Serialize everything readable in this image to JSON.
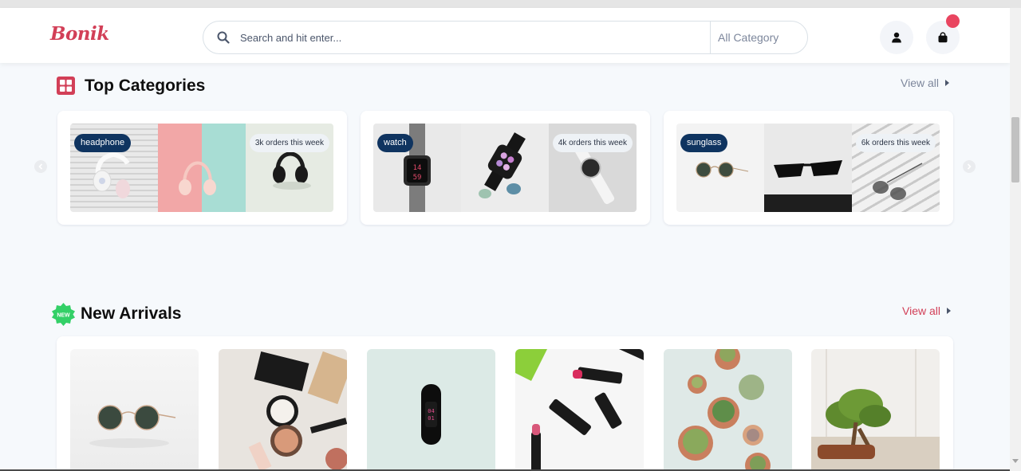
{
  "header": {
    "logo": "Bonik",
    "search_placeholder": "Search and hit enter...",
    "category_select": "All Category",
    "accent": "#d23f57",
    "icons": [
      "search-icon",
      "user-icon",
      "shopping-bag-icon"
    ]
  },
  "top_categories": {
    "title": "Top Categories",
    "view_all": "View all",
    "icon": "grid-icon",
    "cards": [
      {
        "label": "headphone",
        "orders": "3k orders this week"
      },
      {
        "label": "watch",
        "orders": "4k orders this week"
      },
      {
        "label": "sunglass",
        "orders": "6k orders this week"
      }
    ]
  },
  "new_arrivals": {
    "title": "New Arrivals",
    "badge": "NEW",
    "view_all": "View all",
    "view_all_color": "#d23f57",
    "products": [
      "sunglasses",
      "makeup",
      "fitness band",
      "lipstick",
      "succulents",
      "bonsai"
    ]
  }
}
